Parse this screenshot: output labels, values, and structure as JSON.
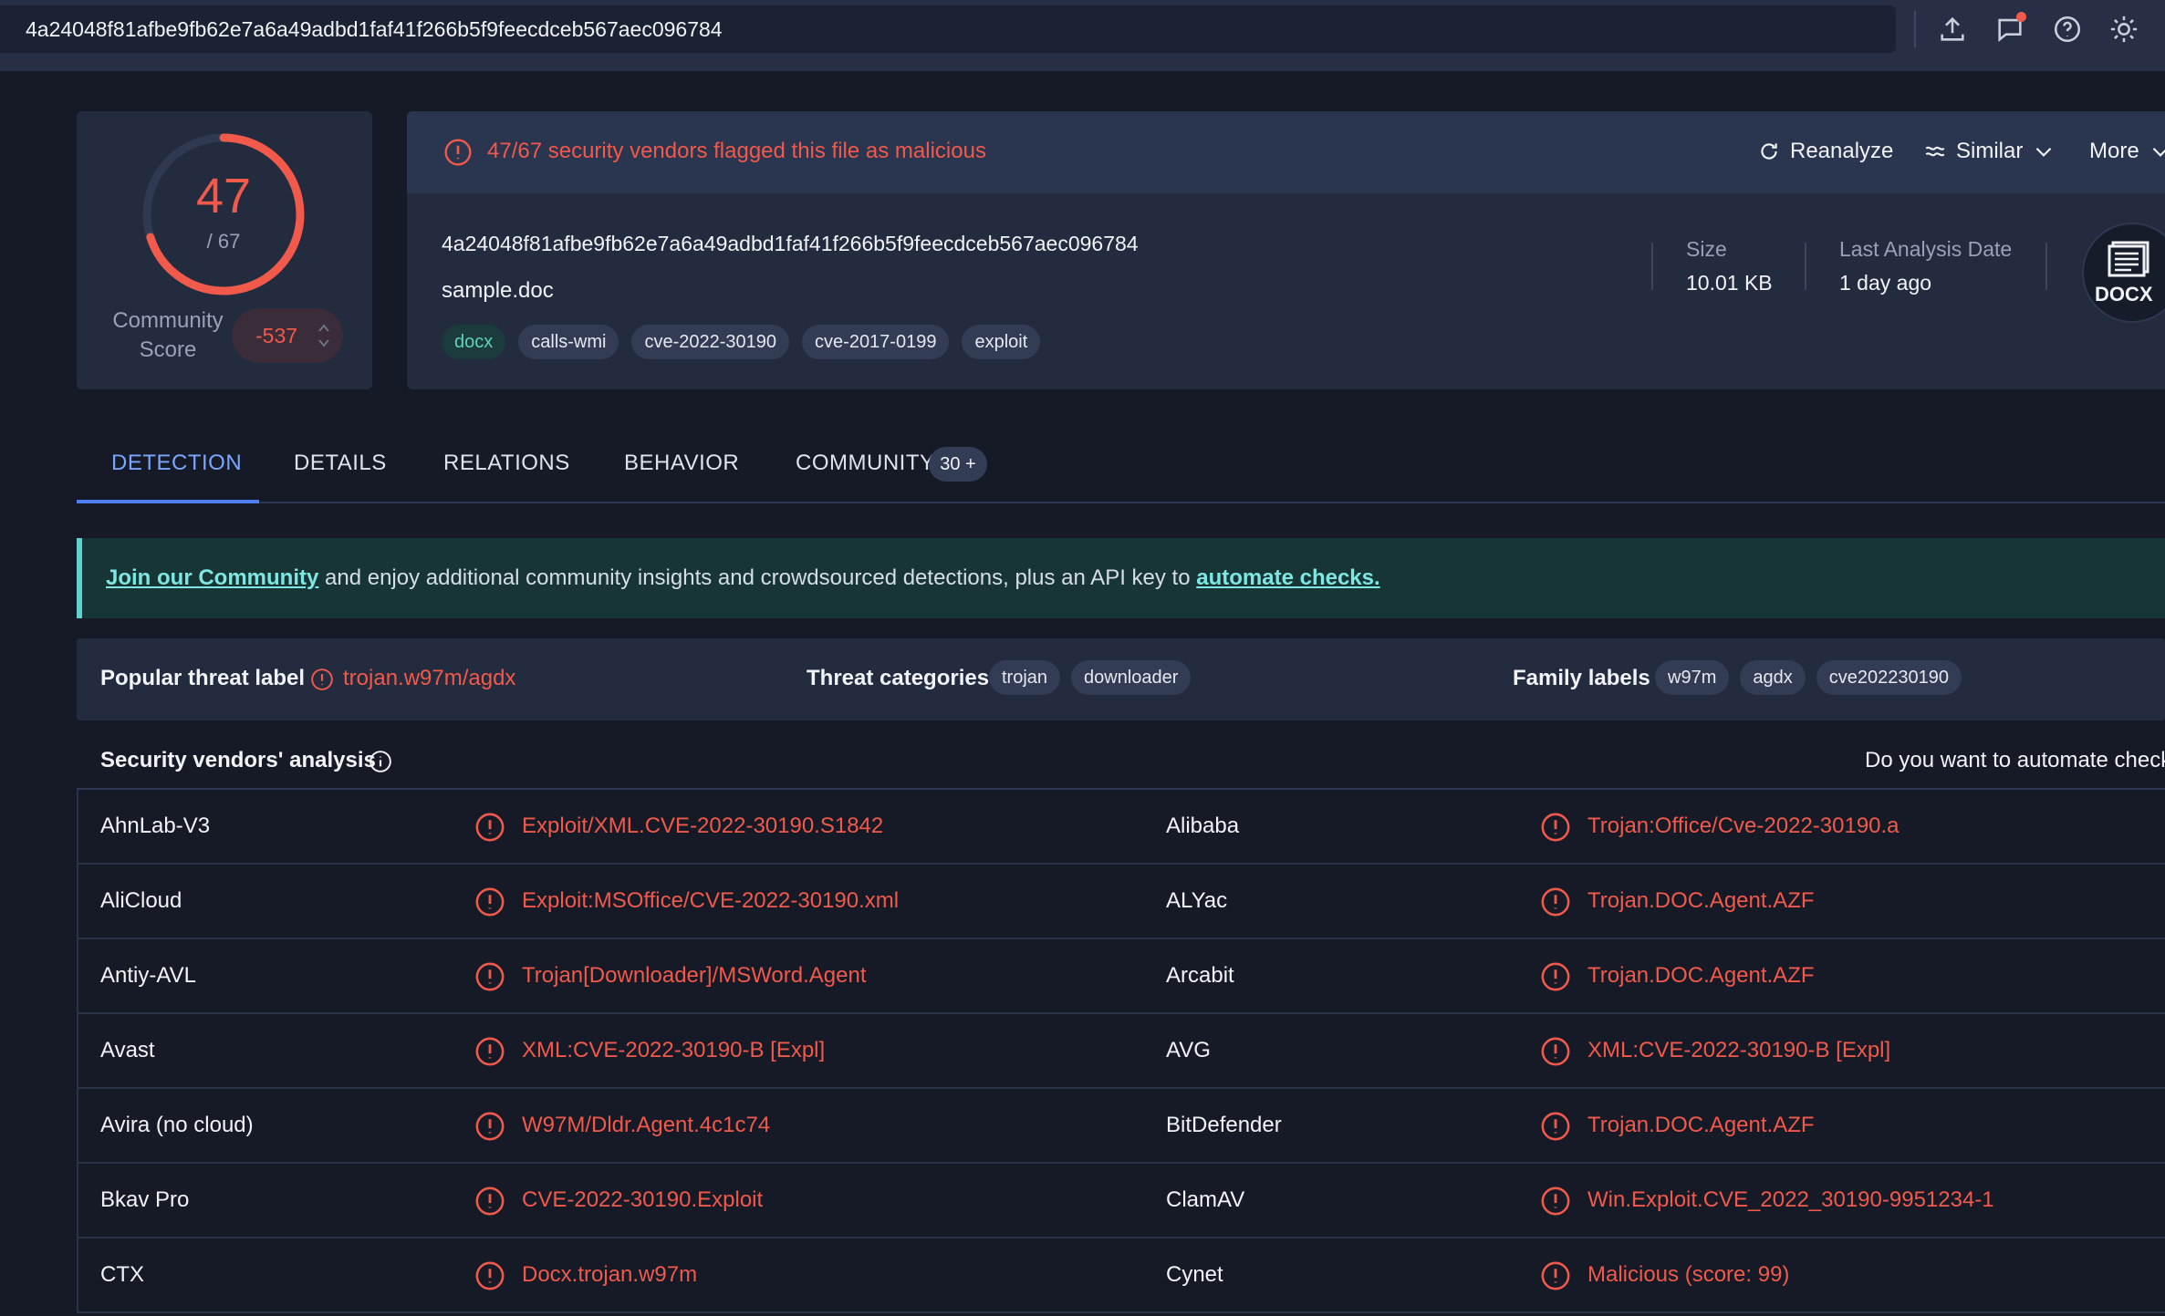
{
  "search": {
    "value": "4a24048f81afbe9fb62e7a6a49adbd1faf41f266b5f9feecdceb567aec096784"
  },
  "top_icons": [
    "upload-icon",
    "chat-icon",
    "help-icon",
    "theme-icon"
  ],
  "score": {
    "detected": "47",
    "total": "/ 67",
    "detected_value": 47,
    "total_value": 67,
    "community_label": "Community Score",
    "community_value": "-537"
  },
  "alert": {
    "text": "47/67 security vendors flagged this file as malicious",
    "reanalyze": "Reanalyze",
    "similar": "Similar",
    "more": "More"
  },
  "file": {
    "hash": "4a24048f81afbe9fb62e7a6a49adbd1faf41f266b5f9feecdceb567aec096784",
    "name": "sample.doc",
    "tags": [
      "docx",
      "calls-wmi",
      "cve-2022-30190",
      "cve-2017-0199",
      "exploit"
    ],
    "size_label": "Size",
    "size_value": "10.01 KB",
    "date_label": "Last Analysis Date",
    "date_value": "1 day ago",
    "type_badge": "DOCX"
  },
  "tabs": [
    {
      "label": "DETECTION"
    },
    {
      "label": "DETAILS"
    },
    {
      "label": "RELATIONS"
    },
    {
      "label": "BEHAVIOR"
    },
    {
      "label": "COMMUNITY"
    }
  ],
  "community_badge": "30 +",
  "banner": {
    "link1": "Join our Community",
    "middle": " and enjoy additional community insights and crowdsourced detections, plus an API key to ",
    "link2": "automate checks."
  },
  "threat": {
    "popular_label": "Popular threat label",
    "popular_value": "trojan.w97m/agdx",
    "categories_label": "Threat categories",
    "categories": [
      "trojan",
      "downloader"
    ],
    "family_label": "Family labels",
    "families": [
      "w97m",
      "agdx",
      "cve202230190"
    ]
  },
  "vendors": {
    "title": "Security vendors' analysis",
    "automate_prompt": "Do you want to automate check",
    "rows": [
      {
        "v1": "AhnLab-V3",
        "r1": "Exploit/XML.CVE-2022-30190.S1842",
        "v2": "Alibaba",
        "r2": "Trojan:Office/Cve-2022-30190.a"
      },
      {
        "v1": "AliCloud",
        "r1": "Exploit:MSOffice/CVE-2022-30190.xml",
        "v2": "ALYac",
        "r2": "Trojan.DOC.Agent.AZF"
      },
      {
        "v1": "Antiy-AVL",
        "r1": "Trojan[Downloader]/MSWord.Agent",
        "v2": "Arcabit",
        "r2": "Trojan.DOC.Agent.AZF"
      },
      {
        "v1": "Avast",
        "r1": "XML:CVE-2022-30190-B [Expl]",
        "v2": "AVG",
        "r2": "XML:CVE-2022-30190-B [Expl]"
      },
      {
        "v1": "Avira (no cloud)",
        "r1": "W97M/Dldr.Agent.4c1c74",
        "v2": "BitDefender",
        "r2": "Trojan.DOC.Agent.AZF"
      },
      {
        "v1": "Bkav Pro",
        "r1": "CVE-2022-30190.Exploit",
        "v2": "ClamAV",
        "r2": "Win.Exploit.CVE_2022_30190-9951234-1"
      },
      {
        "v1": "CTX",
        "r1": "Docx.trojan.w97m",
        "v2": "Cynet",
        "r2": "Malicious (score: 99)"
      }
    ]
  },
  "colors": {
    "malicious": "#f1594b",
    "accent": "#4f7ff0",
    "background": "#151a26",
    "panel": "#232b3e"
  }
}
